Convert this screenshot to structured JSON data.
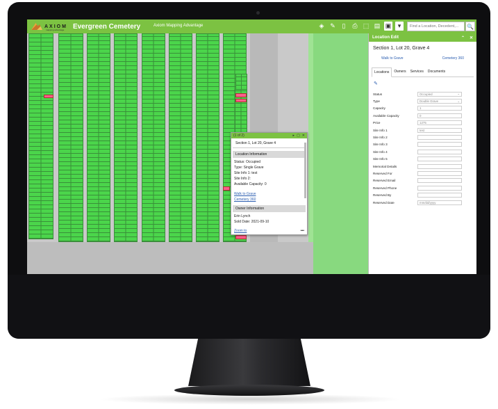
{
  "app": {
    "logo_text": "AXIOM",
    "logo_sub": "mapping advantage",
    "title": "Evergreen Cemetery",
    "subtitle": "Axiom Mapping Advantage"
  },
  "toolbar": {
    "search_placeholder": "Find a Location, Decedent,...",
    "search_icon": "🔍",
    "icons": [
      {
        "name": "layers-icon",
        "glyph": "◈"
      },
      {
        "name": "measure-icon",
        "glyph": "✎"
      },
      {
        "name": "bookmark-icon",
        "glyph": "▯"
      },
      {
        "name": "print-icon",
        "glyph": "⎙"
      },
      {
        "name": "export-icon",
        "glyph": "⬚"
      },
      {
        "name": "filter-icon",
        "glyph": "▤"
      },
      {
        "name": "list-icon",
        "glyph": "▣"
      }
    ],
    "dropdown_glyph": "▾"
  },
  "map_controls": {
    "zoom_in": "+",
    "zoom_out": "−",
    "home": "⌂",
    "fullscreen": "⛶",
    "back": "←",
    "forward": "→"
  },
  "popup": {
    "counter": "(1 of 2)",
    "next_glyph": "▸",
    "max_glyph": "▢",
    "close_glyph": "✕",
    "title": "Section 1, Lot 20, Grave 4",
    "location_header": "Location Information",
    "status": "Status: Occupied",
    "type": "Type: Single Grave",
    "site1": "Site Info 1: test",
    "site2": "Site Info 2:",
    "capacity": "Available Capacity: 0",
    "walk_link": "Walk to Grave",
    "cemetery_link": "Cemetery 360",
    "owner_header": "Owner Information",
    "owner_name": "Erin Lynch",
    "sold_date": "Sold Date: 2021-09-10",
    "zoom_link": "Zoom to",
    "more_glyph": "•••"
  },
  "panel": {
    "header": "Location Edit",
    "collapse_glyph": "⌃",
    "close_glyph": "✕",
    "title": "Section 1, Lot 20, Grave 4",
    "walk_link": "Walk to Grave",
    "cemetery_link": "Cemetery 360",
    "tabs": [
      "Locations",
      "Owners",
      "Services",
      "Documents"
    ],
    "edit_glyph": "✎",
    "fields": [
      {
        "label": "Status",
        "value": "Occupied",
        "select": true
      },
      {
        "label": "Type",
        "value": "Double Grave",
        "select": true
      },
      {
        "label": "Capacity",
        "value": "1",
        "select": false
      },
      {
        "label": "Available Capacity",
        "value": "0",
        "select": false
      },
      {
        "label": "Price",
        "value": "1275",
        "select": false
      },
      {
        "label": "Site Info 1",
        "value": "test",
        "select": false
      },
      {
        "label": "Site Info 2",
        "value": "",
        "select": false
      },
      {
        "label": "Site Info 3",
        "value": "",
        "select": false
      },
      {
        "label": "Site Info 4",
        "value": "",
        "select": false
      },
      {
        "label": "Site Info 5",
        "value": "",
        "select": false
      },
      {
        "label": "Memorial Details",
        "value": "",
        "select": false
      },
      {
        "label": "Reserved For",
        "value": "",
        "select": false
      },
      {
        "label": "Reserved Email",
        "value": "",
        "select": false
      },
      {
        "label": "Reserved Phone",
        "value": "",
        "select": false
      },
      {
        "label": "Reserved By",
        "value": "",
        "select": false
      },
      {
        "label": "Reserved Date",
        "value": "mm/dd/yyyy",
        "select": false
      }
    ],
    "select_glyph": "⌄"
  },
  "colors": {
    "brand_green": "#7cc242",
    "grave_green": "#4bd54b",
    "occupied_pink": "#ff5c8a",
    "link_blue": "#2a5db0"
  }
}
